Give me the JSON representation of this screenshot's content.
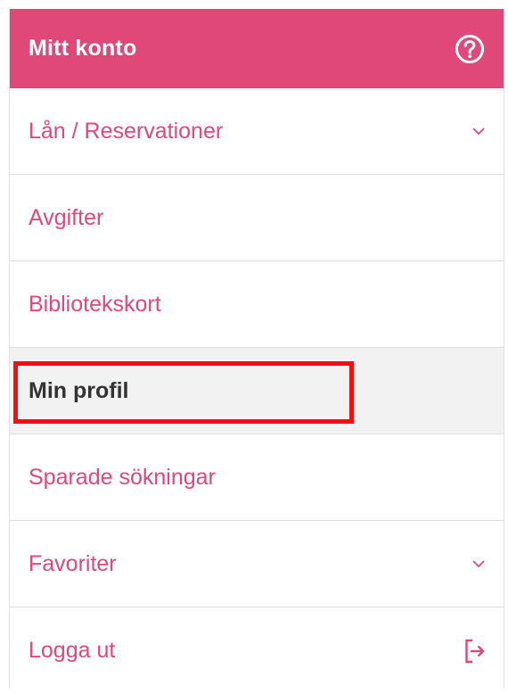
{
  "header": {
    "title": "Mitt konto",
    "help_icon": "question-circle-icon",
    "brand_color": "#e0487a"
  },
  "menu": {
    "items": [
      {
        "label": "Lån / Reservationer",
        "icon": "chevron-down-icon"
      },
      {
        "label": "Avgifter"
      },
      {
        "label": "Bibliotekskort"
      },
      {
        "label": "Min profil",
        "active": true,
        "highlighted": true
      },
      {
        "label": "Sparade sökningar"
      },
      {
        "label": "Favoriter",
        "icon": "chevron-down-icon"
      },
      {
        "label": "Logga ut",
        "icon": "logout-icon"
      }
    ]
  },
  "colors": {
    "link": "#e0487a",
    "active_text": "#333333",
    "active_bg": "#f2f2f2",
    "highlight_border": "#ee1111"
  }
}
